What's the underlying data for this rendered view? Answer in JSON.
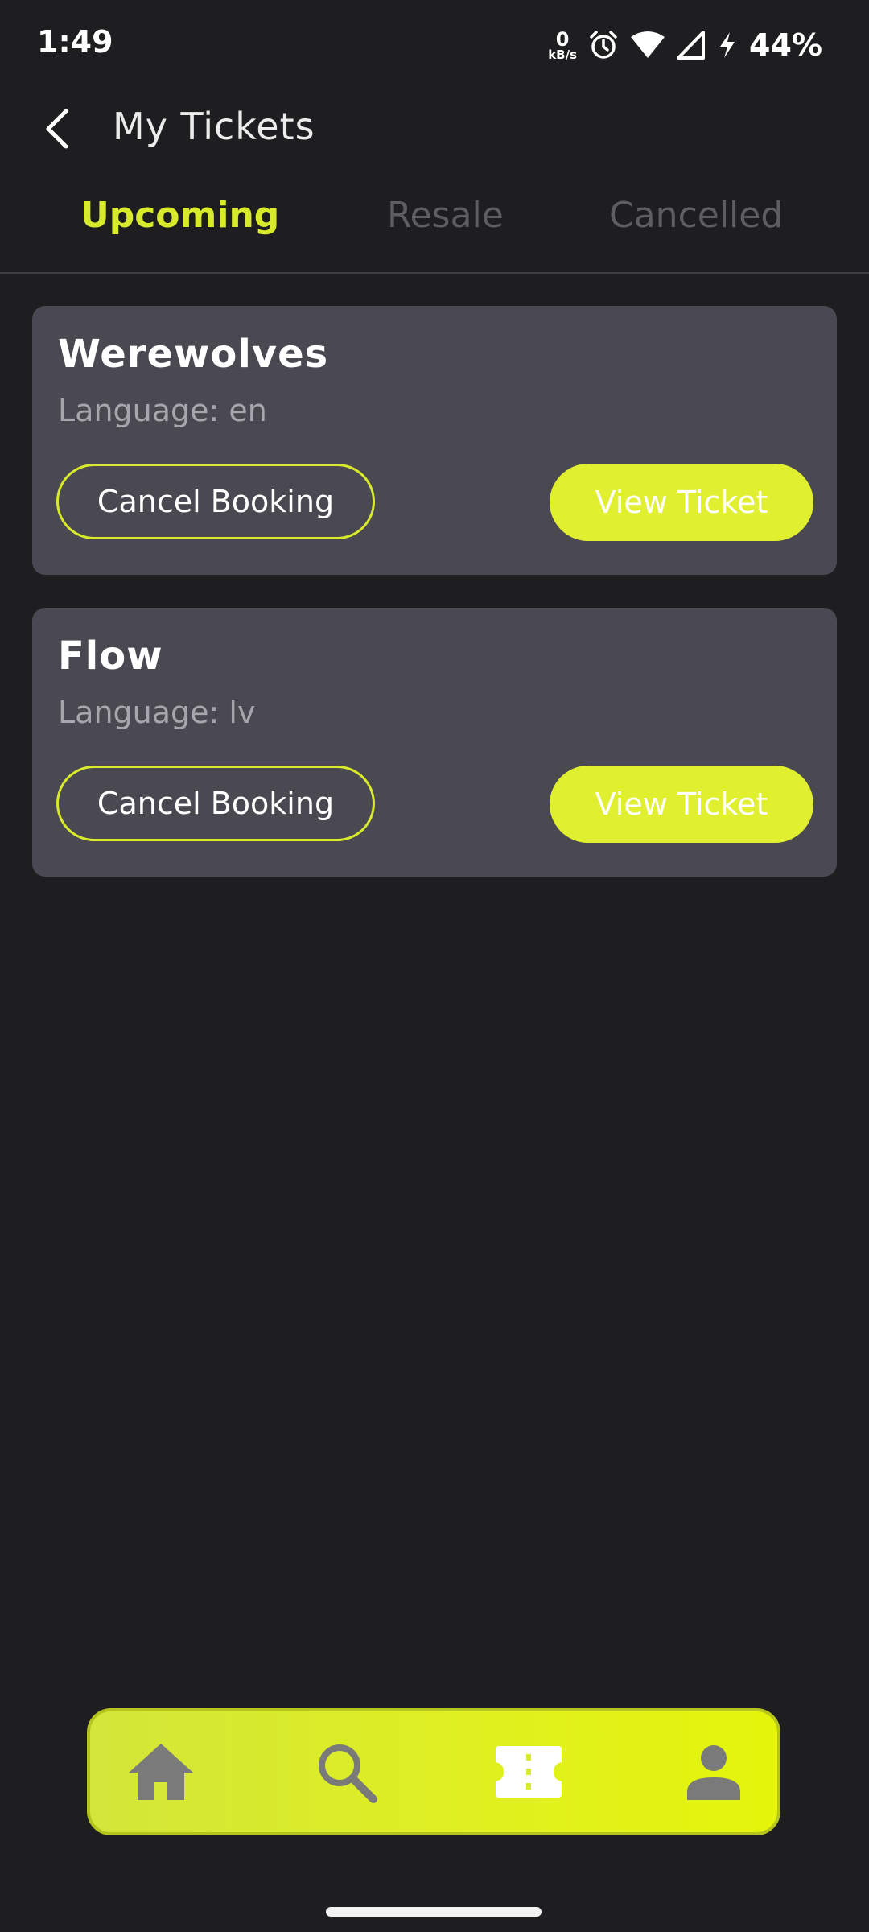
{
  "status_bar": {
    "time": "1:49",
    "net_speed_value": "0",
    "net_speed_unit": "kB/s",
    "battery": "44%"
  },
  "app_bar": {
    "title": "My Tickets"
  },
  "tabs": [
    {
      "label": "Upcoming",
      "active": true
    },
    {
      "label": "Resale",
      "active": false
    },
    {
      "label": "Cancelled",
      "active": false
    }
  ],
  "tickets": [
    {
      "title": "Werewolves",
      "language": "Language: en",
      "cancel_label": "Cancel Booking",
      "view_label": "View Ticket"
    },
    {
      "title": "Flow",
      "language": "Language: lv",
      "cancel_label": "Cancel Booking",
      "view_label": "View Ticket"
    }
  ],
  "bottom_nav": [
    {
      "icon": "home-icon"
    },
    {
      "icon": "search-icon"
    },
    {
      "icon": "ticket-icon",
      "active": true
    },
    {
      "icon": "profile-icon"
    }
  ],
  "colors": {
    "background": "#1e1e20",
    "accent": "#d8ea2c",
    "card": "#4a4850",
    "nav_icon": "#7a7a7a"
  }
}
